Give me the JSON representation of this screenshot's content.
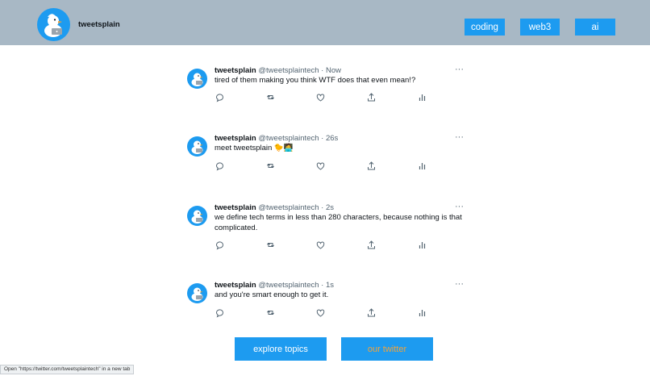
{
  "header": {
    "brand": "tweetsplain",
    "logo_icon": "duck-mascot-icon",
    "nav": [
      {
        "label": "coding"
      },
      {
        "label": "web3"
      },
      {
        "label": "ai"
      }
    ]
  },
  "tweets": [
    {
      "name": "tweetsplain",
      "handle": "@tweetsplaintech",
      "time": "· Now",
      "text": "tired of them making you think WTF does that even mean!?"
    },
    {
      "name": "tweetsplain",
      "handle": "@tweetsplaintech",
      "time": "· 26s",
      "text": "meet tweetsplain 🐤🧑‍💻"
    },
    {
      "name": "tweetsplain",
      "handle": "@tweetsplaintech",
      "time": "· 2s",
      "text": "we define tech terms in less than 280 characters, because nothing is that complicated."
    },
    {
      "name": "tweetsplain",
      "handle": "@tweetsplaintech",
      "time": "· 1s",
      "text": "and you're smart enough to get it."
    }
  ],
  "tweet_more_label": "···",
  "tweet_action_icons": [
    "reply-icon",
    "retweet-icon",
    "like-icon",
    "share-icon",
    "analytics-icon"
  ],
  "cta": {
    "explore": "explore topics",
    "twitter": "our twitter"
  },
  "status_bar": "Open \"https://twitter.com/tweetsplaintech\" in a new tab",
  "colors": {
    "header_bg": "#a8b8c5",
    "accent": "#1d9bf0",
    "twitter_button_text": "#f2a33a"
  }
}
